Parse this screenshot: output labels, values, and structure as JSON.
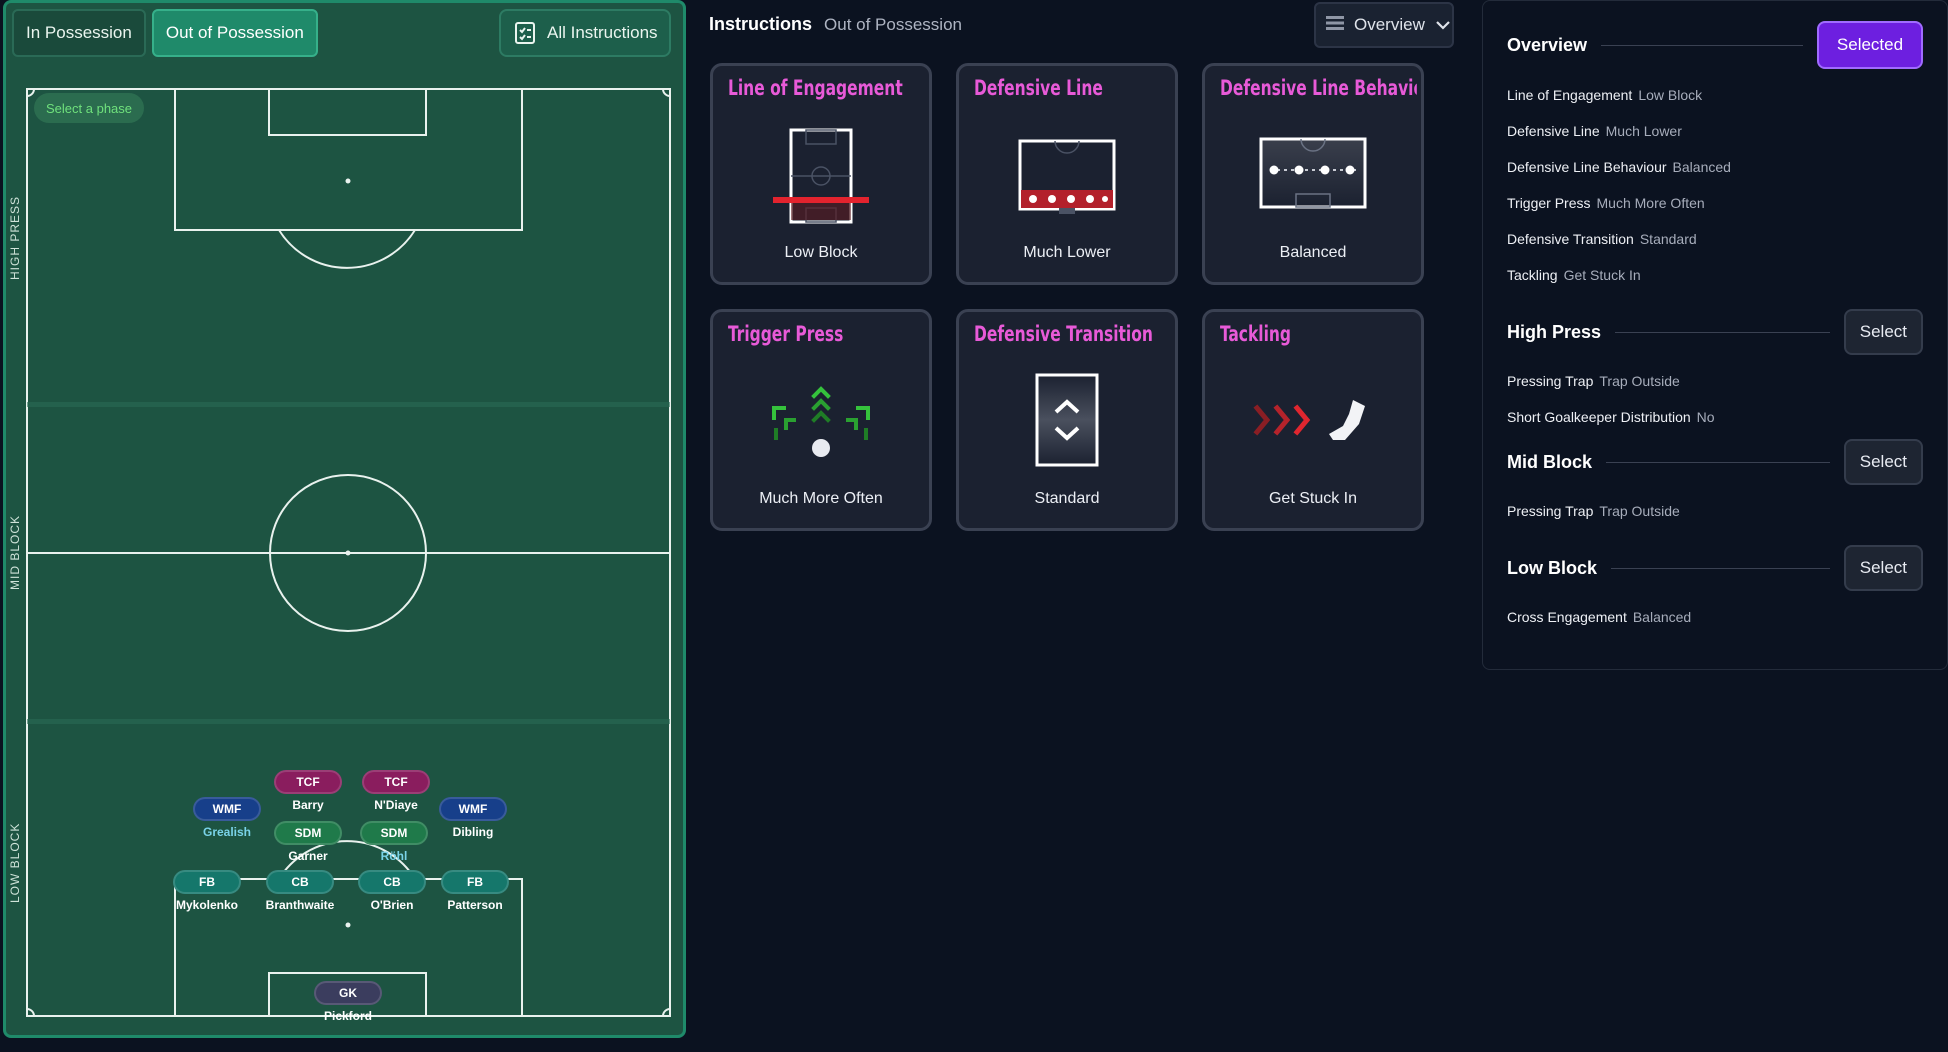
{
  "tabs": {
    "in_possession": "In Possession",
    "out_of_possession": "Out of Possession",
    "all_instructions": "All Instructions"
  },
  "pitch": {
    "select_phase": "Select a phase",
    "phases": [
      "HIGH PRESS",
      "MID BLOCK",
      "LOW BLOCK"
    ],
    "players": [
      {
        "pos": "TCF",
        "name": "Barry",
        "color": "#8a1d5e"
      },
      {
        "pos": "TCF",
        "name": "N'Diaye",
        "color": "#8a1d5e"
      },
      {
        "pos": "WMF",
        "name": "Grealish",
        "color": "#173f8a"
      },
      {
        "pos": "SDM",
        "name": "Garner",
        "color": "#1f7a4a"
      },
      {
        "pos": "SDM",
        "name": "Röhl",
        "color": "#1f7a4a"
      },
      {
        "pos": "WMF",
        "name": "Dibling",
        "color": "#173f8a"
      },
      {
        "pos": "FB",
        "name": "Mykolenko",
        "color": "#15776b"
      },
      {
        "pos": "CB",
        "name": "Branthwaite",
        "color": "#15776b"
      },
      {
        "pos": "CB",
        "name": "O'Brien",
        "color": "#15776b"
      },
      {
        "pos": "FB",
        "name": "Patterson",
        "color": "#15776b"
      },
      {
        "pos": "GK",
        "name": "Pickford",
        "color": "#3b3d5e"
      }
    ]
  },
  "instructions": {
    "title": "Instructions",
    "subtitle": "Out of Possession",
    "view_dropdown": "Overview",
    "cards": [
      {
        "title": "Line of Engagement",
        "value": "Low Block",
        "icon": "line-of-engagement-icon"
      },
      {
        "title": "Defensive Line",
        "value": "Much Lower",
        "icon": "defensive-line-icon"
      },
      {
        "title": "Defensive Line Behaviour",
        "value": "Balanced",
        "icon": "defensive-line-behaviour-icon"
      },
      {
        "title": "Trigger Press",
        "value": "Much More Often",
        "icon": "trigger-press-icon"
      },
      {
        "title": "Defensive Transition",
        "value": "Standard",
        "icon": "defensive-transition-icon"
      },
      {
        "title": "Tackling",
        "value": "Get Stuck In",
        "icon": "tackling-boot-icon"
      }
    ]
  },
  "overview": {
    "sections": [
      {
        "title": "Overview",
        "button": "Selected",
        "rows": [
          {
            "k": "Line of Engagement",
            "v": "Low Block"
          },
          {
            "k": "Defensive Line",
            "v": "Much Lower"
          },
          {
            "k": "Defensive Line Behaviour",
            "v": "Balanced"
          },
          {
            "k": "Trigger Press",
            "v": "Much More Often"
          },
          {
            "k": "Defensive Transition",
            "v": "Standard"
          },
          {
            "k": "Tackling",
            "v": "Get Stuck In"
          }
        ]
      },
      {
        "title": "High Press",
        "button": "Select",
        "rows": [
          {
            "k": "Pressing Trap",
            "v": "Trap Outside"
          },
          {
            "k": "Short Goalkeeper Distribution",
            "v": "No"
          }
        ]
      },
      {
        "title": "Mid Block",
        "button": "Select",
        "rows": [
          {
            "k": "Pressing Trap",
            "v": "Trap Outside"
          }
        ]
      },
      {
        "title": "Low Block",
        "button": "Select",
        "rows": [
          {
            "k": "Cross Engagement",
            "v": "Balanced"
          }
        ]
      }
    ]
  },
  "colors": {
    "pitch": "#1d5442",
    "accent_green": "#1f8a6a",
    "card_title": "#e85ad8",
    "selected_button": "#6d1fe0"
  }
}
